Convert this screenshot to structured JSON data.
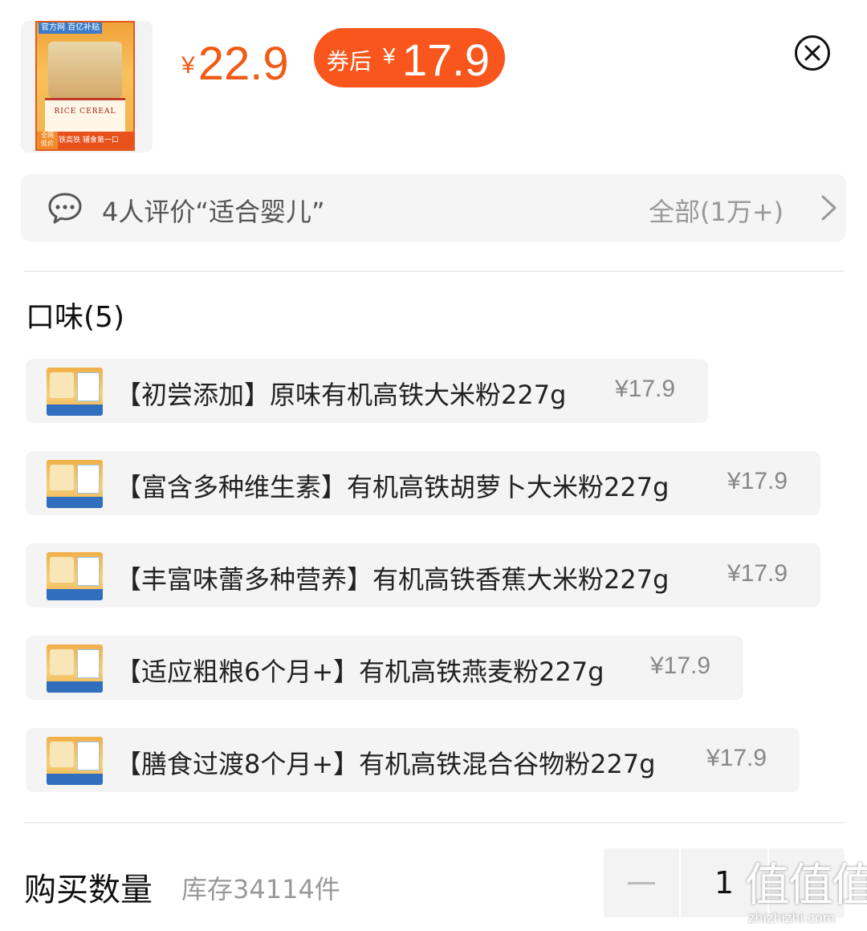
{
  "product": {
    "image_icon": "rice-cereal-box-image",
    "box_badge": "官方网 百亿补贴",
    "box_label": "RICE CEREAL",
    "box_strip": "高铁高铁 辅食第一口",
    "box_corner": "全网 低价"
  },
  "price": {
    "currency": "¥",
    "original": "22.9",
    "coupon_label": "券后",
    "coupon_currency": "¥",
    "coupon_price": "17.9"
  },
  "review": {
    "text": "4人评价“适合婴儿”",
    "all_label": "全部(1万+)"
  },
  "flavor_section": {
    "title": "口味(5)",
    "options": [
      {
        "name": "【初尝添加】原味有机高铁大米粉227g",
        "price": "¥17.9"
      },
      {
        "name": "【富含多种维生素】有机高铁胡萝卜大米粉227g",
        "price": "¥17.9"
      },
      {
        "name": "【丰富味蕾多种营养】有机高铁香蕉大米粉227g",
        "price": "¥17.9"
      },
      {
        "name": "【适应粗粮6个月+】有机高铁燕麦粉227g",
        "price": "¥17.9"
      },
      {
        "name": "【膳食过渡8个月+】有机高铁混合谷物粉227g",
        "price": "¥17.9"
      }
    ]
  },
  "quantity": {
    "label": "购买数量",
    "stock": "库存34114件",
    "value": "1"
  },
  "watermark": {
    "big": "值值值",
    "small": "zhizhizhi.com"
  },
  "colors": {
    "accent": "#f8561c",
    "price_text": "#f25a16",
    "panel_bg": "#f5f5f5"
  }
}
